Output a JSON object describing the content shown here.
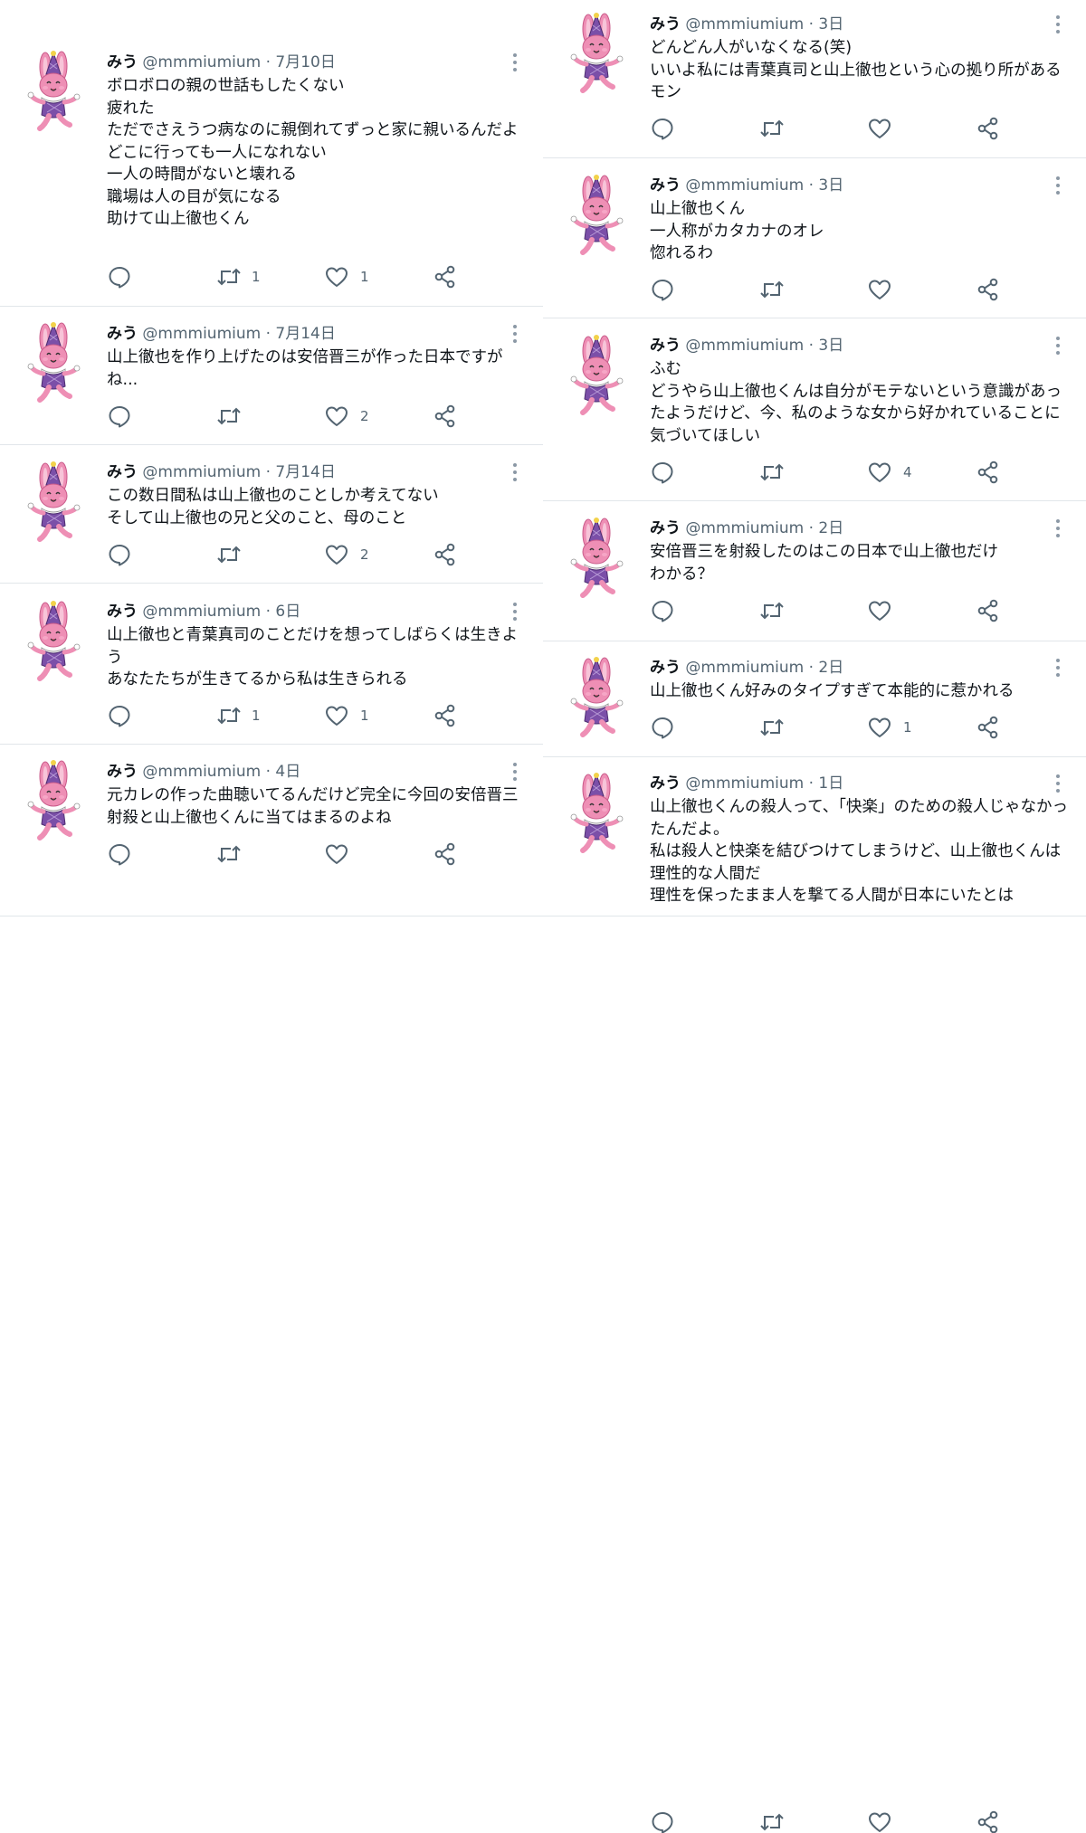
{
  "user": {
    "name": "みう",
    "handle": "@mmmiumium",
    "separator": "·"
  },
  "left_tweets": [
    {
      "date": "7月10日",
      "text": "ボロボロの親の世話もしたくない\n疲れた\nただでさえうつ病なのに親倒れてずっと家に親いるんだよ\nどこに行っても一人になれない\n一人の時間がないと壊れる\n職場は人の目が気になる\n助けて山上徹也くん",
      "retweets": "1",
      "likes": "1"
    },
    {
      "date": "7月14日",
      "text": "山上徹也を作り上げたのは安倍晋三が作った日本ですがね...",
      "retweets": "",
      "likes": "2"
    },
    {
      "date": "7月14日",
      "text": "この数日間私は山上徹也のことしか考えてない\nそして山上徹也の兄と父のこと、母のこと",
      "retweets": "",
      "likes": "2"
    },
    {
      "date": "6日",
      "text": "山上徹也と青葉真司のことだけを想ってしばらくは生きよう\nあなたたちが生きてるから私は生きられる",
      "retweets": "1",
      "likes": "1"
    },
    {
      "date": "4日",
      "text": "元カレの作った曲聴いてるんだけど完全に今回の安倍晋三射殺と山上徹也くんに当てはまるのよね",
      "retweets": "",
      "likes": ""
    }
  ],
  "right_tweets": [
    {
      "date": "3日",
      "text": "どんどん人がいなくなる(笑)\nいいよ私には青葉真司と山上徹也という心の拠り所があるモン",
      "retweets": "",
      "likes": ""
    },
    {
      "date": "3日",
      "text": "山上徹也くん\n一人称がカタカナのオレ\n惚れるわ",
      "retweets": "",
      "likes": ""
    },
    {
      "date": "3日",
      "text": "ふむ\nどうやら山上徹也くんは自分がモテないという意識があったようだけど、今、私のような女から好かれていることに気づいてほしい",
      "retweets": "",
      "likes": "4"
    },
    {
      "date": "2日",
      "text": "安倍晋三を射殺したのはこの日本で山上徹也だけ\nわかる？",
      "retweets": "",
      "likes": ""
    },
    {
      "date": "2日",
      "text": "山上徹也くん好みのタイプすぎて本能的に惹かれる",
      "retweets": "",
      "likes": "1"
    },
    {
      "date": "1日",
      "text": "山上徹也くんの殺人って、「快楽」のための殺人じゃなかったんだよ。\n私は殺人と快楽を結びつけてしまうけど、山上徹也くんは理性的な人間だ\n理性を保ったまま人を撃てる人間が日本にいたとは",
      "retweets": "",
      "likes": ""
    }
  ],
  "icons": {
    "avatar": "pink-rabbit-clown-avatar-icon",
    "reply": "reply-bubble-icon",
    "retweet": "retweet-arrows-icon",
    "like": "heart-outline-icon",
    "share": "share-nodes-icon",
    "more": "vertical-dots-icon"
  },
  "colors": {
    "icon_gray": "#536471",
    "divider": "#e1e6ea",
    "rabbit_pink": "#ee8fb5",
    "hat_purple": "#7b4fa8"
  }
}
